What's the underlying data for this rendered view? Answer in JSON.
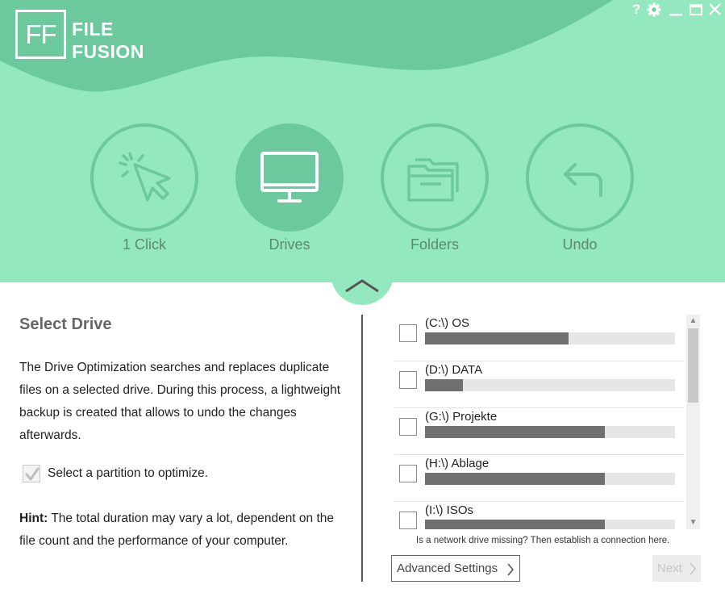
{
  "app": {
    "logo_mark": "FF",
    "logo_line1": "FILE",
    "logo_line2": "FUSION",
    "help_label": "?"
  },
  "colors": {
    "header_bg": "#93e8bf",
    "header_wave": "#6cc99e",
    "active_circle": "#6cc99e",
    "bar_fill": "#707070",
    "bar_track": "#e6e6e6"
  },
  "nav": [
    {
      "label": "1 Click",
      "icon": "cursor-click-icon",
      "active": false
    },
    {
      "label": "Drives",
      "icon": "monitor-icon",
      "active": true
    },
    {
      "label": "Folders",
      "icon": "folder-icon",
      "active": false
    },
    {
      "label": "Undo",
      "icon": "undo-arrow-icon",
      "active": false
    }
  ],
  "panel": {
    "title": "Select Drive",
    "description": "The Drive Optimization searches and replaces duplicate files on a selected drive. During this process, a lightweight backup is created that allows to undo the changes afterwards.",
    "task_label": "Select a partition to optimize.",
    "task_done": true,
    "hint_label": "Hint:",
    "hint_text": " The total duration may vary a lot, dependent on the file count and the performance of your computer."
  },
  "drives": [
    {
      "label": "(C:\\) OS",
      "used_fraction": 0.575,
      "checked": false
    },
    {
      "label": "(D:\\) DATA",
      "used_fraction": 0.15,
      "checked": false
    },
    {
      "label": "(G:\\) Projekte",
      "used_fraction": 0.72,
      "checked": false
    },
    {
      "label": "(H:\\) Ablage",
      "used_fraction": 0.72,
      "checked": false
    },
    {
      "label": "(I:\\) ISOs",
      "used_fraction": 0.72,
      "checked": false
    }
  ],
  "network_link": "Is a network drive missing? Then establish a connection here.",
  "buttons": {
    "advanced": "Advanced Settings",
    "next": "Next"
  }
}
